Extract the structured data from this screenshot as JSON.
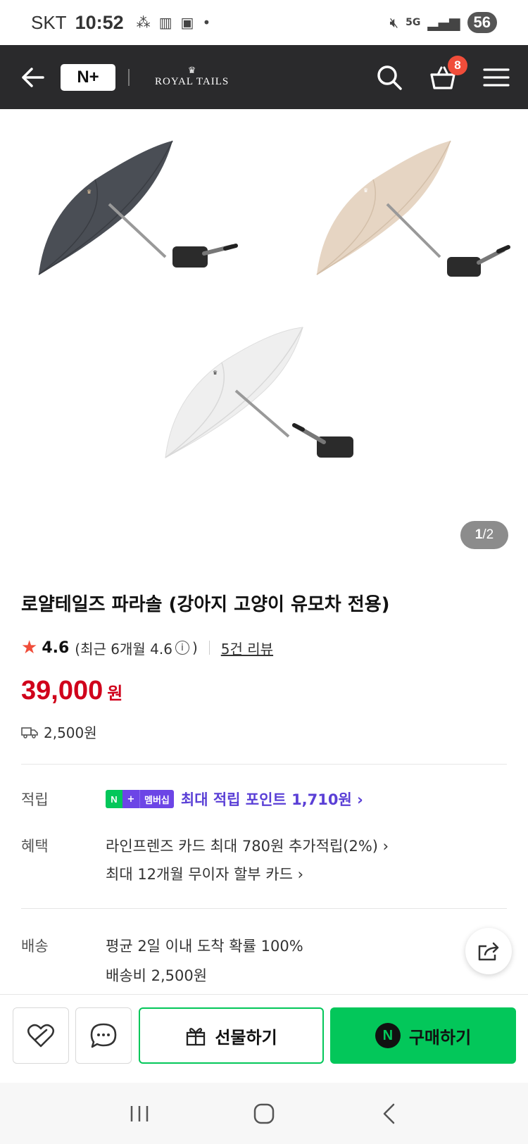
{
  "status_bar": {
    "carrier": "SKT",
    "time": "10:52",
    "network": "5G",
    "battery": "56"
  },
  "header": {
    "nplus_logo": "N+",
    "brand": "ROYAL TAILS",
    "cart_count": "8",
    "icons": [
      "back-arrow-icon",
      "search-icon",
      "cart-icon",
      "menu-icon"
    ]
  },
  "gallery": {
    "current_page": "1",
    "total_pages": "2",
    "separator": "/",
    "umbrella_colors": [
      "#4a4e55",
      "#e6d5c3",
      "#efefef"
    ]
  },
  "product": {
    "title": "로얄테일즈 파라솔 (강아지 고양이 유모차 전용)",
    "rating": "4.6",
    "rating_recent_prefix": "(최근 6개월 4.6",
    "rating_recent_suffix": ")",
    "info_icon": "i",
    "reviews": "5건 리뷰",
    "price": "39,000",
    "price_unit": "원",
    "shipping_fee": "2,500원"
  },
  "details": {
    "points_label": "적립",
    "member_badge": "멤버십",
    "points_text": "최대 적립 포인트 1,710원 ›",
    "benefits_label": "혜택",
    "benefit_1": "라인프렌즈 카드 최대 780원 추가적립(2%) ›",
    "benefit_2": "최대 12개월 무이자 할부 카드 ›",
    "delivery_label": "배송",
    "delivery_1": "평균 2일 이내 도착 확률 100%",
    "delivery_2": "배송비 2,500원"
  },
  "actions": {
    "gift_label": "선물하기",
    "buy_label": "구매하기",
    "npay_glyph": "N"
  },
  "colors": {
    "header_bg": "#2a2a2c",
    "price": "#d0021b",
    "naver_green": "#03c75a",
    "membership_purple": "#6c45e6",
    "badge_red": "#f04d3a"
  }
}
